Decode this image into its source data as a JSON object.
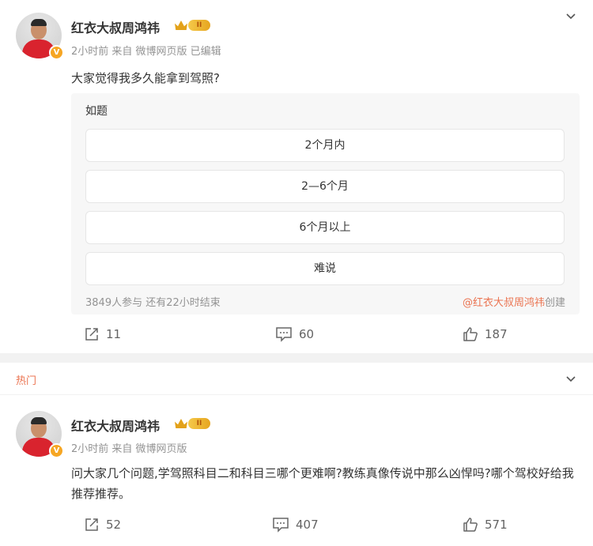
{
  "posts": [
    {
      "author": "红衣大叔周鸿祎",
      "badge_level": "II",
      "verified": "V",
      "meta": "2小时前  来自 微博网页版 已编辑",
      "text": "大家觉得我多久能拿到驾照?",
      "poll": {
        "title": "如题",
        "options": [
          "2个月内",
          "2—6个月",
          "6个月以上",
          "难说"
        ],
        "footer": "3849人参与  还有22小时结束",
        "creator_mention": "@红衣大叔周鸿祎",
        "creator_suffix": "创建"
      },
      "actions": {
        "repost": "11",
        "comment": "60",
        "like": "187"
      }
    },
    {
      "author": "红衣大叔周鸿祎",
      "badge_level": "II",
      "verified": "V",
      "meta": "2小时前  来自 微博网页版",
      "text": "问大家几个问题,学驾照科目二和科目三哪个更难啊?教练真像传说中那么凶悍吗?哪个驾校好给我推荐推荐。",
      "actions": {
        "repost": "52",
        "comment": "407",
        "like": "571"
      }
    }
  ],
  "hot_section": {
    "label": "热门"
  },
  "colors": {
    "accent": "#eb7350",
    "badge": "#f6a623",
    "meta": "#939393"
  }
}
